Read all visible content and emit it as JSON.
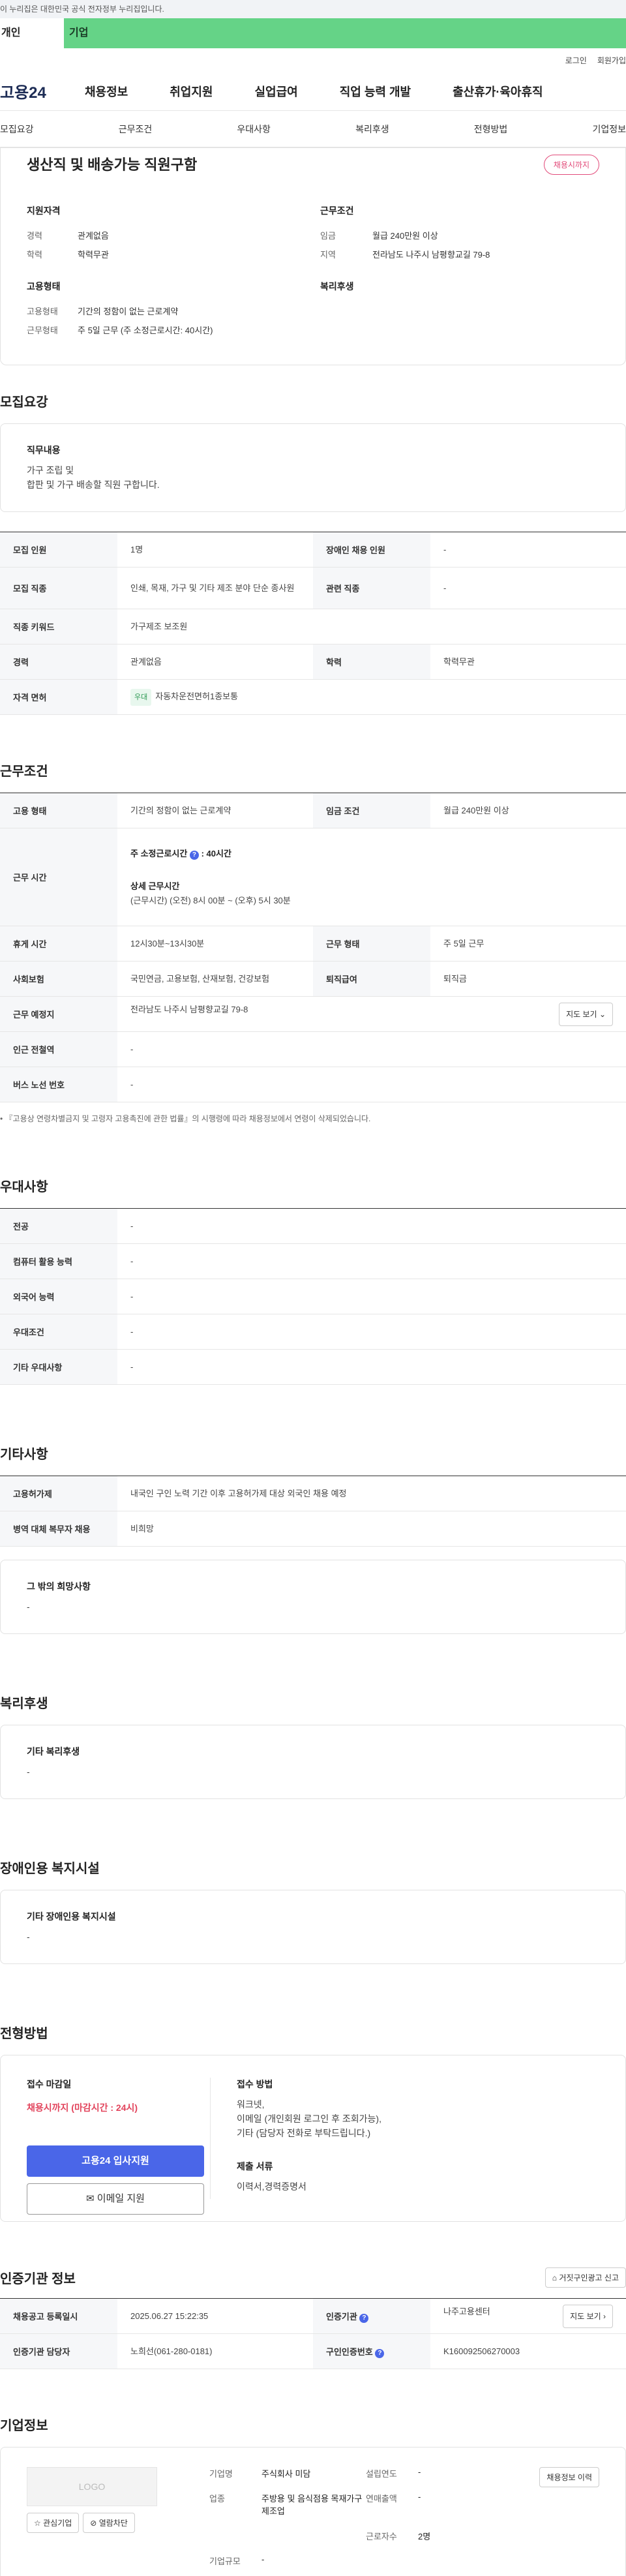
{
  "gov_banner": "이 누리집은 대한민국 공식 전자정부 누리집입니다.",
  "top_tabs": {
    "personal": "개인",
    "company": "기업"
  },
  "util_links": [
    "로그인",
    "회원가입"
  ],
  "logo": "고용24",
  "main_nav": [
    "채용정보",
    "취업지원",
    "실업급여",
    "직업 능력 개발",
    "출산휴가·육아휴직"
  ],
  "anchor_nav": [
    "모집요강",
    "근무조건",
    "우대사항",
    "복리후생",
    "전형방법",
    "기업정보"
  ],
  "summary": {
    "title": "생산직 및 배송가능 직원구함",
    "status": "채용시까지",
    "qual_heading": "지원자격",
    "qual": [
      {
        "k": "경력",
        "v": "관계없음"
      },
      {
        "k": "학력",
        "v": "학력무관"
      }
    ],
    "work_heading": "근무조건",
    "work": [
      {
        "k": "임금",
        "v": "월급 240만원 이상"
      },
      {
        "k": "지역",
        "v": "전라남도 나주시 남평향교길 79-8"
      }
    ],
    "type_heading": "고용형태",
    "type": [
      {
        "k": "고용형태",
        "v": "기간의 정함이 없는 근로계약"
      },
      {
        "k": "근무형태",
        "v": "주 5일 근무 (주 소정근로시간: 40시간)"
      }
    ],
    "welfare_heading": "복리후생"
  },
  "recruit": {
    "section_title": "모집요강",
    "duty_heading": "직무내용",
    "duty_text_1": "가구 조립 및",
    "duty_text_2": "합판 및 가구 배송할 직원 구합니다.",
    "rows": {
      "count_k": "모집 인원",
      "count_v": "1명",
      "disabled_k": "장애인 채용 인원",
      "disabled_v": "-",
      "job_k": "모집 직종",
      "job_v": "인쇄, 목재, 가구 및 기타 제조 분야 단순 종사원",
      "related_k": "관련 직종",
      "related_v": "-",
      "keyword_k": "직종 키워드",
      "keyword_v": "가구제조 보조원",
      "career_k": "경력",
      "career_v": "관계없음",
      "edu_k": "학력",
      "edu_v": "학력무관",
      "license_k": "자격 면허",
      "license_tag": "우대",
      "license_v": "자동차운전면허1종보통"
    }
  },
  "conditions": {
    "section_title": "근무조건",
    "type_k": "고용 형태",
    "type_v": "기간의 정함이 없는 근로계약",
    "wage_k": "임금 조건",
    "wage_v": "월급 240만원 이상",
    "hours_k": "근무 시간",
    "hours_week_label": "주 소정근로시간",
    "hours_week_value": ": 40시간",
    "hours_detail_label": "상세 근무시간",
    "hours_detail_value": "(근무시간) (오전) 8시 00분 ~ (오후) 5시 30분",
    "break_k": "휴게 시간",
    "break_v": "12시30분~13시30분",
    "shape_k": "근무 형태",
    "shape_v": "주 5일 근무",
    "insure_k": "사회보험",
    "insure_v": "국민연금, 고용보험, 산재보험, 건강보험",
    "retire_k": "퇴직급여",
    "retire_v": "퇴직금",
    "place_k": "근무 예정지",
    "place_v": "전라남도 나주시 남평향교길 79-8",
    "map_btn": "지도 보기",
    "station_k": "인근 전철역",
    "station_v": "-",
    "bus_k": "버스 노선 번호",
    "bus_v": "-",
    "note": "『고용상 연령차별금지 및 고령자 고용촉진에 관한 법률』의 시행령에 따라 채용정보에서 연령이 삭제되었습니다."
  },
  "preference": {
    "section_title": "우대사항",
    "rows": [
      {
        "k": "전공",
        "v": "-"
      },
      {
        "k": "컴퓨터 활용 능력",
        "v": "-"
      },
      {
        "k": "외국어 능력",
        "v": "-"
      },
      {
        "k": "우대조건",
        "v": "-"
      },
      {
        "k": "기타 우대사항",
        "v": "-"
      }
    ]
  },
  "etc": {
    "section_title": "기타사항",
    "rows": [
      {
        "k": "고용허가제",
        "v": "내국인 구인 노력 기간 이후 고용허가제 대상 외국인 채용 예정"
      },
      {
        "k": "병역 대체 복무자 채용",
        "v": "비희망"
      }
    ],
    "box_heading": "그 밖의 희망사항",
    "box_text": "-"
  },
  "welfare": {
    "section_title": "복리후생",
    "box_heading": "기타 복리후생",
    "box_text": "-"
  },
  "facility": {
    "section_title": "장애인용 복지시설",
    "box_heading": "기타 장애인용 복지시설",
    "box_text": "-"
  },
  "process": {
    "section_title": "전형방법",
    "deadline_heading": "접수 마감일",
    "deadline_value": "채용시까지 (마감시간 : 24시)",
    "apply_btn": "고용24 입사지원",
    "email_btn": "이메일 지원",
    "method_heading": "접수 방법",
    "method_lines": [
      "워크넷,",
      "이메일 (개인회원 로그인 후 조회가능),",
      "기타 (담당자 전화로 부탁드립니다.)"
    ],
    "docs_heading": "제출 서류",
    "docs_value": "이력서,경력증명서"
  },
  "agency": {
    "section_title": "인증기관 정보",
    "report_btn": "거짓구인광고 신고",
    "reg_k": "채용공고 등록일시",
    "reg_v": "2025.06.27 15:22:35",
    "org_k": "인증기관",
    "org_v": "나주고용센터",
    "map_btn": "지도 보기",
    "mgr_k": "인증기관 담당자",
    "mgr_v": "노희선(061-280-0181)",
    "num_k": "구인인증번호",
    "num_v": "K160092506270003"
  },
  "company": {
    "section_title": "기업정보",
    "logo_placeholder": "LOGO",
    "interest_btn": "관심기업",
    "block_btn": "열람차단",
    "history_btn": "채용정보 이력",
    "name_k": "기업명",
    "name_v": "주식회사 미담",
    "year_k": "설립연도",
    "year_v": "-",
    "industry_k": "업종",
    "industry_v": "주방용 및 음식점용 목재가구 제조업",
    "sales_k": "연매출액",
    "sales_v": "-",
    "emp_k": "근로자수",
    "emp_v": "2명",
    "size_k": "기업규모",
    "size_v": "-"
  }
}
